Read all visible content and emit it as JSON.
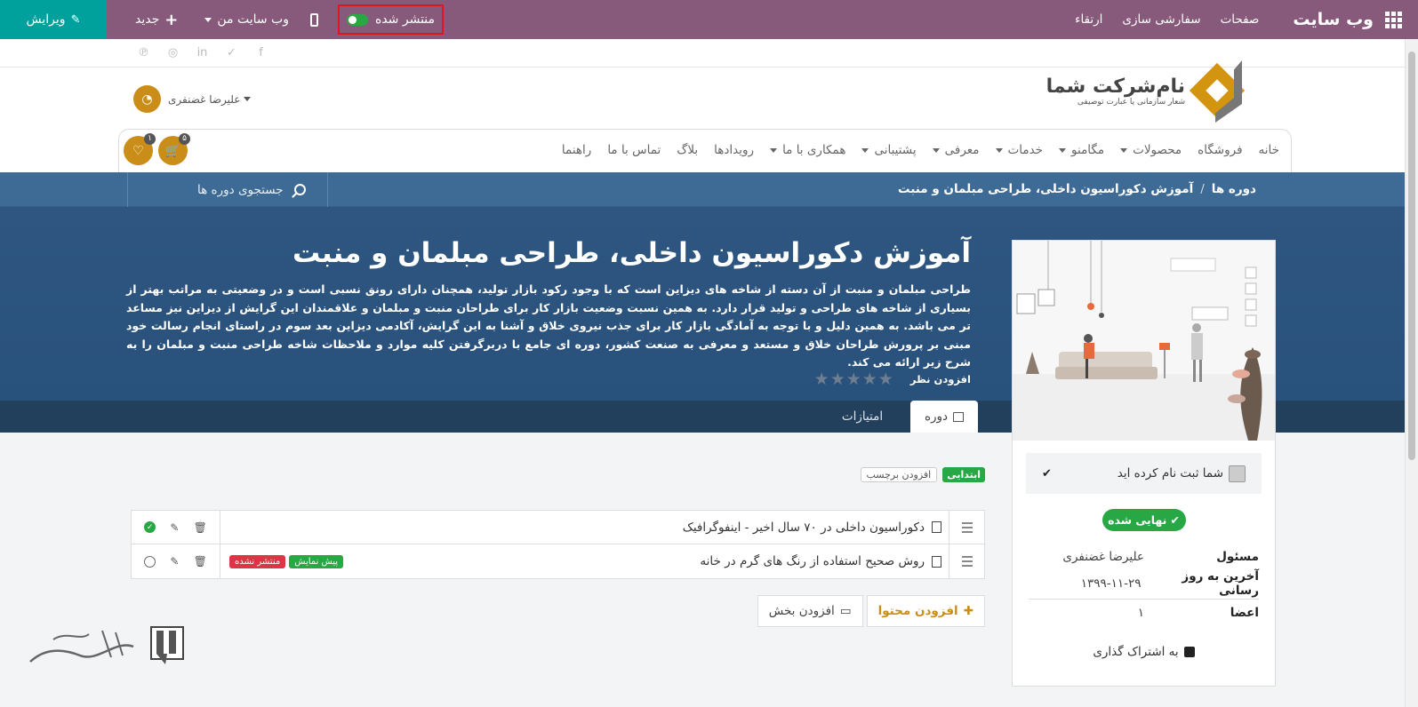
{
  "topbar": {
    "brand": "وب سایت",
    "menu": [
      "صفحات",
      "سفارشی سازی",
      "ارتقاء"
    ],
    "published_label": "منتشر شده",
    "my_site_label": "وب سایت من",
    "new_label": "جدید",
    "edit_label": "ویرایش"
  },
  "header": {
    "company_name": "نام‌شرکت شما",
    "company_slogan": "شعار سازمانی یا عبارت توصیفی",
    "user_name": "علیرضا غضنفری",
    "nav": [
      "خانه",
      "فروشگاه",
      "محصولات",
      "مگامنو",
      "خدمات",
      "معرفی",
      "پشتیبانی",
      "همکاری با ما",
      "رویدادها",
      "بلاگ",
      "تماس با ما",
      "راهنما"
    ],
    "nav_dropdowns": [
      "محصولات",
      "مگامنو",
      "خدمات",
      "معرفی",
      "پشتیبانی",
      "همکاری با ما"
    ],
    "cart_count": "۵",
    "wishlist_count": "۱"
  },
  "breadcrumb": {
    "root": "دوره ها",
    "sep": "/",
    "current": "آموزش دکوراسیون داخلی، طراحی مبلمان و منبت",
    "search_placeholder": "جستجوی دوره ها"
  },
  "course": {
    "title": "آموزش دکوراسیون داخلی، طراحی مبلمان و منبت",
    "description": "طراحی مبلمان و منبت از آن دسته از شاخه های دیزاین است که با وجود رکود بازار تولید، همچنان دارای رونق نسبی است و در وضعیتی به مراتب بهتر از بسیاری از شاخه های طراحی و تولید قرار دارد. به همین نسبت وضعیت بازار کار برای طراحان منبت و مبلمان و علاقمندان این گرایش از دیزاین نیز مساعد تر می باشد. به همین دلیل و با توجه به آمادگی بازار کار برای جذب نیروی خلاق و آشنا به این گرایش، آکادمی دیزاین بعد سوم در راستای انجام رسالت خود مبنی بر پرورش طراحان خلاق و مستعد و معرفی به صنعت کشور، دوره ای جامع با دربرگرفتن کلیه موارد و ملاحظات شاخه طراحی منبت و مبلمان را به شرح زیر ارائه می کند.",
    "rating": 0,
    "add_review": "افزودن نظر",
    "tabs": [
      "دوره",
      "امتیازات"
    ]
  },
  "tags": {
    "level": "ابتدایی",
    "add_tag": "افزودن برچسب"
  },
  "contents": [
    {
      "title": "دکوراسیون داخلی در ۷۰ سال اخیر - اینفوگرافیک",
      "published": true,
      "badges": []
    },
    {
      "title": "روش صحیح استفاده از رنگ های گرم در خانه",
      "published": false,
      "badges": [
        "پیش نمایش",
        "منتشر نشده"
      ]
    }
  ],
  "buttons": {
    "add_content": "افزودن محتوا",
    "add_section": "افزودن بخش"
  },
  "sidebar_card": {
    "enrolled_text": "شما ثبت نام کرده اید",
    "status": "نهایی شده",
    "rows": [
      {
        "key": "مسئول",
        "value": "علیرضا غضنفری"
      },
      {
        "key": "آخرین به روز رسانی",
        "value": "۱۳۹۹-۱۱-۲۹"
      },
      {
        "key": "اعضا",
        "value": "۱"
      }
    ],
    "share_label": "به اشتراک گذاری"
  },
  "colors": {
    "topbar": "#875a7b",
    "edit": "#00a09d",
    "accent": "#c98d18",
    "hero": "#2e5681",
    "success": "#28a745",
    "danger": "#dc3545"
  }
}
